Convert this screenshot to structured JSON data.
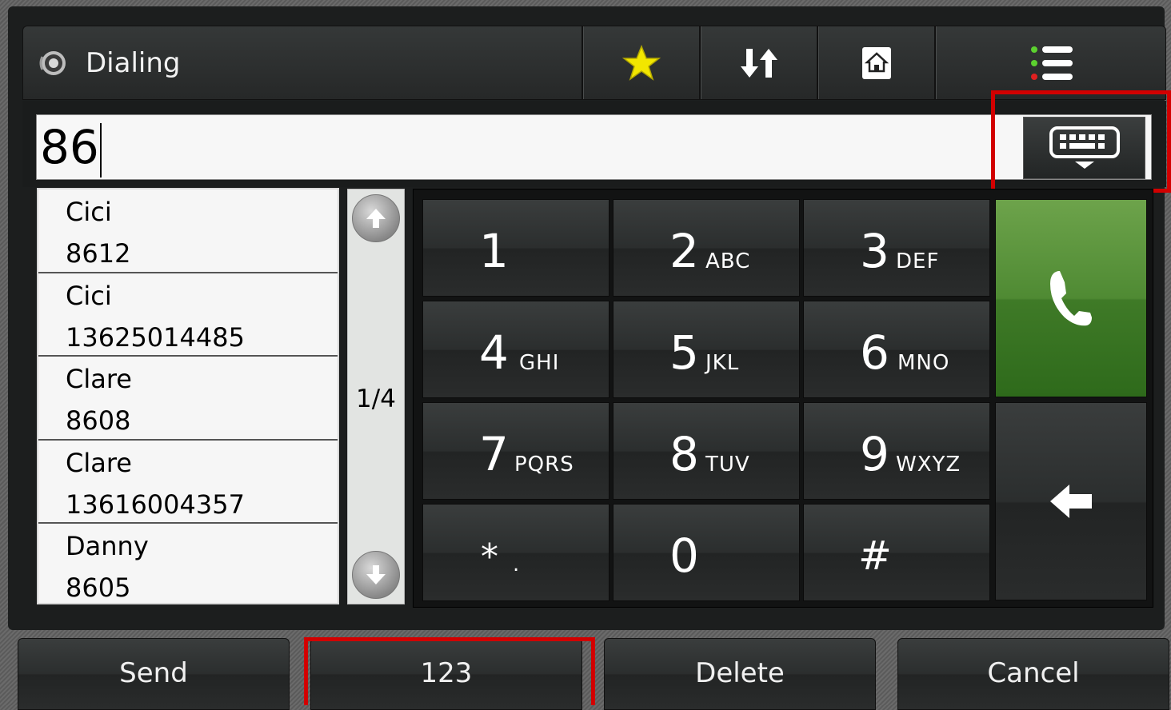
{
  "header": {
    "title": "Dialing",
    "title_icon": "speaker-icon",
    "buttons": [
      {
        "name": "favorites",
        "icon": "star-icon"
      },
      {
        "name": "sort",
        "icon": "sort-arrows-icon"
      },
      {
        "name": "home",
        "icon": "home-icon"
      },
      {
        "name": "menu",
        "icon": "list-menu-icon"
      }
    ]
  },
  "input": {
    "value": "86",
    "keyboard_icon": "keyboard-icon"
  },
  "contacts": [
    {
      "name": "Cici",
      "number": "8612"
    },
    {
      "name": "Cici",
      "number": "13625014485"
    },
    {
      "name": "Clare",
      "number": "8608"
    },
    {
      "name": "Clare",
      "number": "13616004357"
    },
    {
      "name": "Danny",
      "number": "8605"
    }
  ],
  "pager": {
    "indicator": "1/4"
  },
  "keypad": {
    "keys": [
      {
        "digit": "1",
        "letters": ""
      },
      {
        "digit": "2",
        "letters": "ABC"
      },
      {
        "digit": "3",
        "letters": "DEF"
      },
      {
        "digit": "4",
        "letters": "GHI"
      },
      {
        "digit": "5",
        "letters": "JKL"
      },
      {
        "digit": "6",
        "letters": "MNO"
      },
      {
        "digit": "7",
        "letters": "PQRS"
      },
      {
        "digit": "8",
        "letters": "TUV"
      },
      {
        "digit": "9",
        "letters": "WXYZ"
      },
      {
        "digit": "*",
        "letters": "."
      },
      {
        "digit": "0",
        "letters": ""
      },
      {
        "digit": "#",
        "letters": ""
      }
    ],
    "call_icon": "phone-handset-icon",
    "backspace_icon": "back-arrow-icon"
  },
  "softkeys": {
    "send": "Send",
    "mode": "123",
    "delete": "Delete",
    "cancel": "Cancel"
  },
  "colors": {
    "call_green": "#4f8a33",
    "highlight_red": "#d20000",
    "star_yellow": "#f2e600"
  }
}
